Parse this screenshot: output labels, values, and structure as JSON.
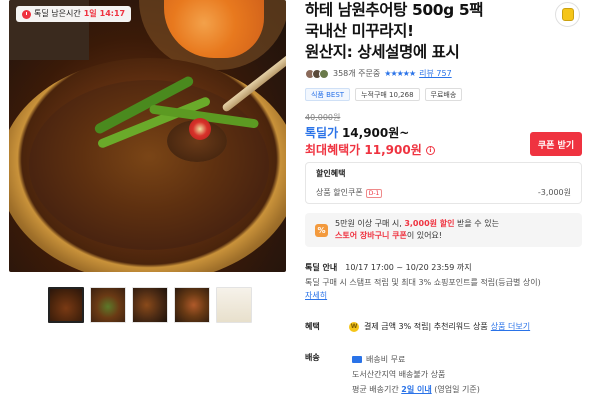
{
  "deal_badge": {
    "prefix": "톡딜 남은시간",
    "day": "1일",
    "time": "14:17"
  },
  "product": {
    "title_line1": "하테 남원추어탕 500g 5팩",
    "title_line2": "국내산 미꾸라지!",
    "title_line3": "원산지: 상세설명에 표시"
  },
  "review": {
    "count_text": "358개 주문중",
    "stars": "★★★★★",
    "review_link": "리뷰 757"
  },
  "tags": {
    "best": "식품 BEST",
    "sales": "누적구매 10,268",
    "free_ship": "무료배송"
  },
  "price": {
    "original": "40,000원",
    "talkdeal_label": "톡딜가",
    "talkdeal_value": "14,900원~",
    "max_label": "최대혜택가",
    "max_value": "11,900원",
    "info_icon": "i"
  },
  "coupon_button": "쿠폰 받기",
  "discount": {
    "title": "할인혜택",
    "item_label": "상품 할인쿠폰",
    "item_badge": "D-1",
    "item_value": "-3,000원"
  },
  "promo": {
    "icon": "%",
    "text1": "5만원 이상 구매 시,",
    "highlight1": "3,000원 할인",
    "text2": "받을 수 있는",
    "highlight2": "스토어 장바구니 쿠폰",
    "text3": "이 있어요!"
  },
  "deal_info": {
    "label": "톡딜 안내",
    "period": "10/17 17:00 ~ 10/20 23:59 까지",
    "desc": "톡딜 구매 시 스탬프 적립 및 최대 3% 쇼핑포인트를 적립(등급별 상이)",
    "more": "자세히"
  },
  "benefit": {
    "label": "혜택",
    "coin": "W",
    "text": "결제 금액 3% 적립| 추천리워드 상품",
    "more": "상품 더보기"
  },
  "shipping": {
    "label": "배송",
    "line1": "배송비 무료",
    "line2": "도서산간지역 배송불가 상품",
    "line3_prefix": "평균 배송기간",
    "line3_bold": "2일 이내",
    "line3_suffix": "(영업일 기준)"
  },
  "colors": {
    "accent_red": "#ef3340",
    "accent_blue": "#2a73e8"
  }
}
